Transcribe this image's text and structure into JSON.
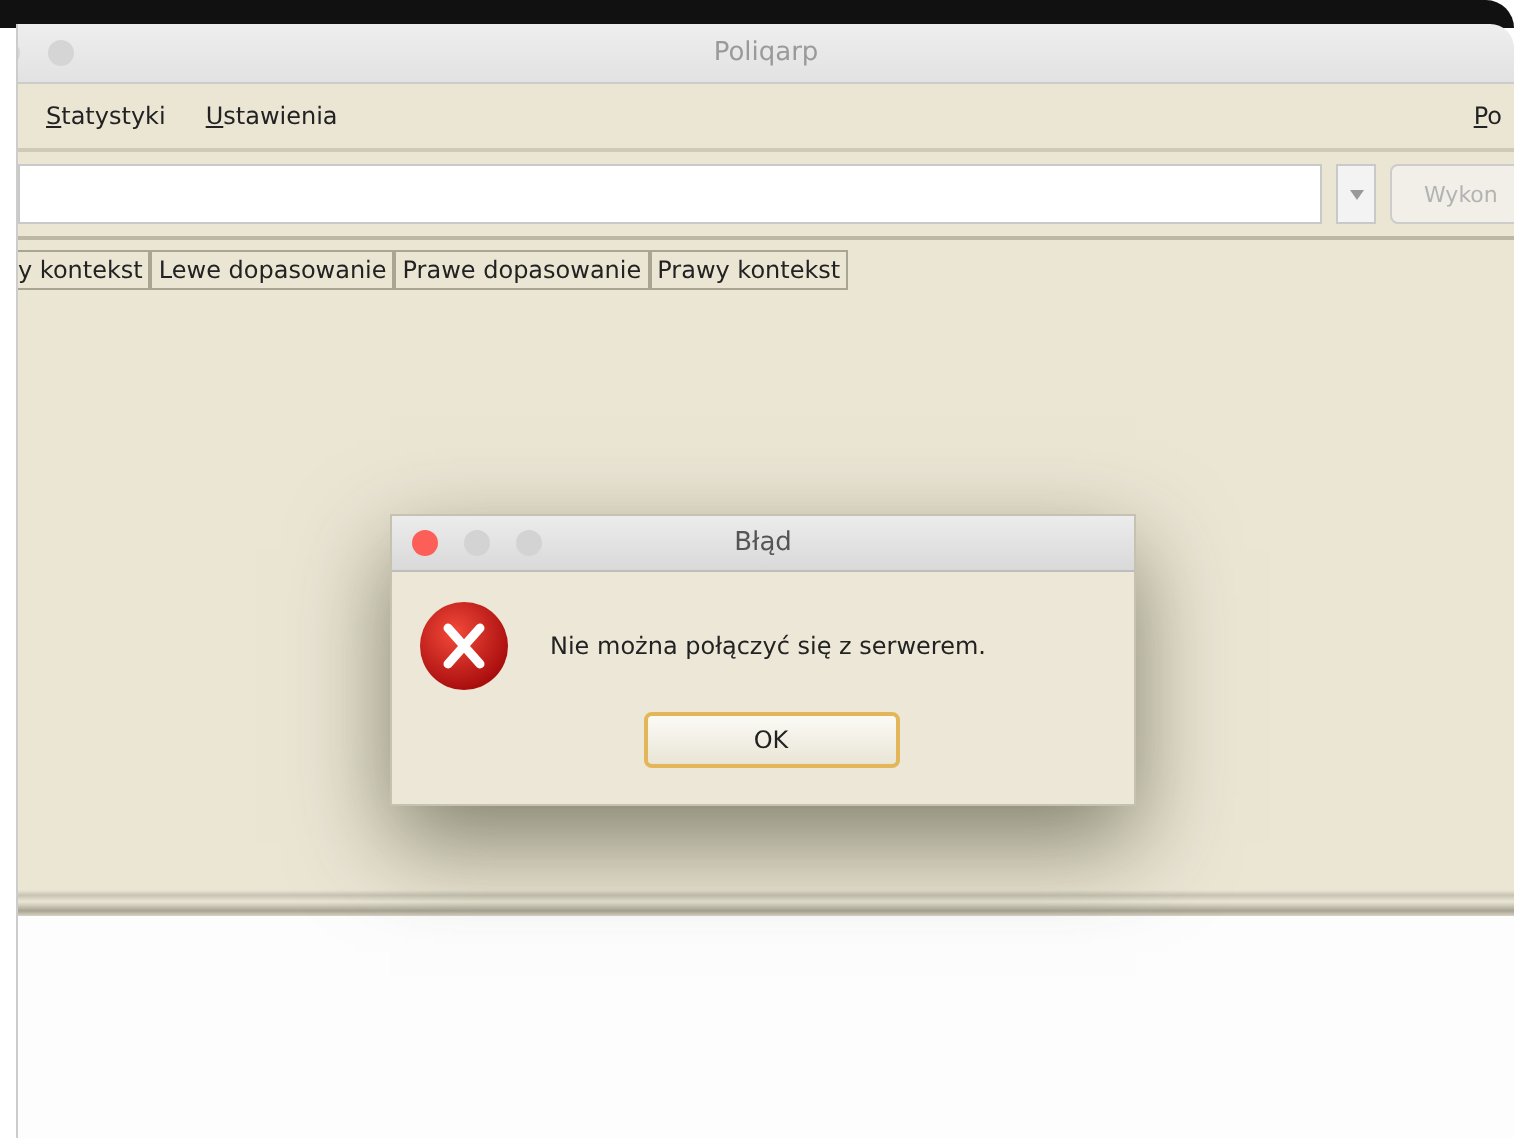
{
  "window": {
    "title": "Poliqarp"
  },
  "menu": {
    "items": [
      {
        "label": "Statystyki"
      },
      {
        "label": "Ustawienia"
      }
    ],
    "right_items": [
      {
        "label": "Po"
      }
    ]
  },
  "run_button": {
    "label": "Wykon",
    "disabled": true
  },
  "columns": [
    "y kontekst",
    "Lewe dopasowanie",
    "Prawe dopasowanie",
    "Prawy kontekst"
  ],
  "dialog": {
    "title": "Błąd",
    "kind": "error",
    "message": "Nie można połączyć się z serwerem.",
    "buttons": [
      {
        "label": "OK",
        "default": true
      }
    ]
  }
}
